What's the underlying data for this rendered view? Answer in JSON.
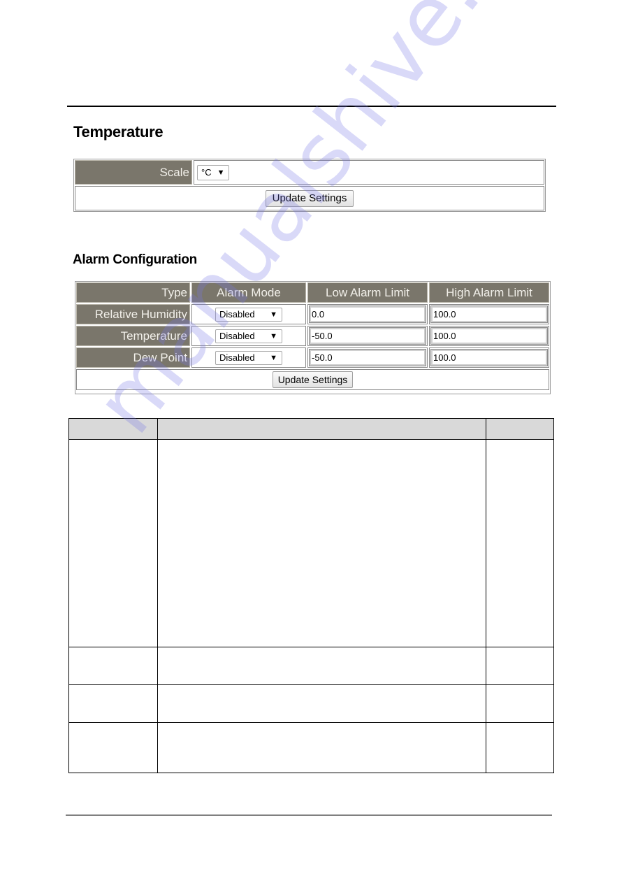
{
  "temperature_section": {
    "title": "Temperature",
    "scale_label": "Scale",
    "scale_value": "°C",
    "update_button": "Update Settings"
  },
  "alarm_section": {
    "title": "Alarm Configuration",
    "columns": [
      "Type",
      "Alarm Mode",
      "Low Alarm Limit",
      "High Alarm Limit"
    ],
    "rows": [
      {
        "type": "Relative Humidity",
        "mode": "Disabled",
        "low": "0.0",
        "high": "100.0"
      },
      {
        "type": "Temperature",
        "mode": "Disabled",
        "low": "-50.0",
        "high": "100.0"
      },
      {
        "type": "Dew Point",
        "mode": "Disabled",
        "low": "-50.0",
        "high": "100.0"
      }
    ],
    "update_button": "Update Settings"
  },
  "icons": {
    "dropdown_arrow": "▼"
  },
  "colors": {
    "web_header_cell": "#7a766b",
    "doc_table_header": "#d9d9d9"
  },
  "watermark": "manualshive.com"
}
